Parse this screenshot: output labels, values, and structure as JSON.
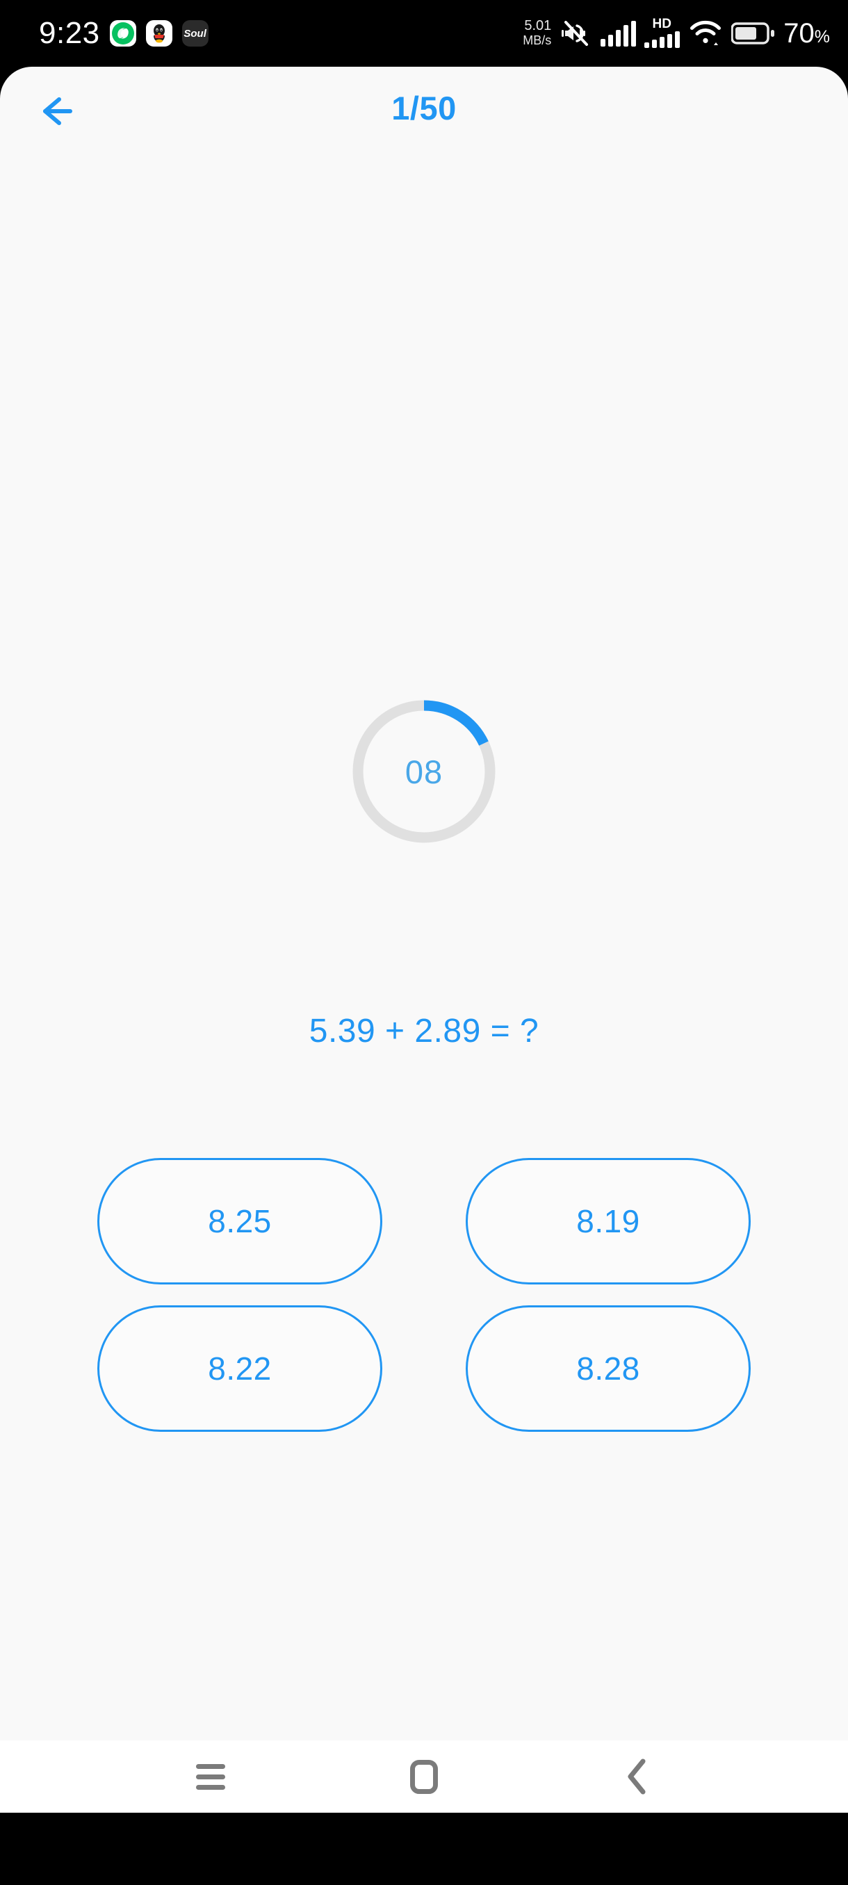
{
  "status_bar": {
    "clock": "9:23",
    "net_speed_value": "5.01",
    "net_speed_unit": "MB/s",
    "battery_percent": "70",
    "battery_percent_symbol": "%",
    "notification_icons": [
      {
        "name": "wechat-work-icon",
        "label": ""
      },
      {
        "name": "qq-icon",
        "label": ""
      },
      {
        "name": "soul-app-icon",
        "label": "Soul"
      }
    ],
    "indicator_icons": [
      "mute-vibrate-icon",
      "signal-sim1-icon",
      "hd-volte-icon",
      "signal-sim2-icon",
      "wifi-icon",
      "battery-icon"
    ],
    "hd_label": "HD",
    "background_color": "#000000",
    "text_color": "#ffffff"
  },
  "header": {
    "back_icon": "arrow-left-icon",
    "title": "1/50",
    "accent_color": "#2196f3"
  },
  "quiz": {
    "timer": {
      "value": "08",
      "progress_percent": 18,
      "track_color": "#e0e0e0",
      "arc_color": "#2196f3",
      "text_color": "#49a7e8"
    },
    "question": "5.39 + 2.89 = ?",
    "question_color": "#2196f3",
    "answers": [
      {
        "label": "8.25"
      },
      {
        "label": "8.19"
      },
      {
        "label": "8.22"
      },
      {
        "label": "8.28"
      }
    ],
    "answer_border_color": "#2196f3",
    "background_color": "#f9f9f9"
  },
  "nav_bar": {
    "recents_icon": "hamburger-recents-icon",
    "home_icon": "home-square-icon",
    "back_icon": "chevron-left-icon",
    "icon_color": "#7b7b7b",
    "background_color": "#ffffff"
  }
}
